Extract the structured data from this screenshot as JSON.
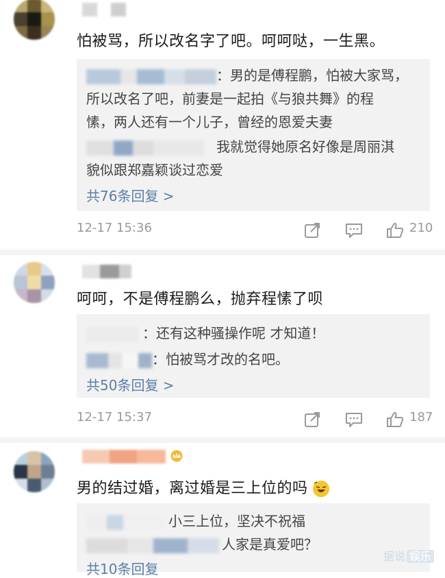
{
  "comments": [
    {
      "text": "怕被骂，所以改名字了吧。呵呵哒，一生黑。",
      "replies": [
        "：男的是傅程鹏，怕被大家骂，",
        "所以改名了吧，前妻是一起拍《与狼共舞》的程",
        "愫，两人还有一个儿子，曾经的恩爱夫妻",
        "我就觉得她原名好像是周丽淇",
        "貌似跟郑嘉颖谈过恋爱"
      ],
      "more_label": "共76条回复 >",
      "time": "12-17 15:36",
      "likes": "210"
    },
    {
      "text": "呵呵，不是傅程鹏么，抛弃程愫了呗",
      "replies": [
        "：还有这种骚操作呢 才知道！",
        "：怕被骂才改的名吧。"
      ],
      "more_label": "共50条回复 >",
      "time": "12-17 15:37",
      "likes": "187"
    },
    {
      "text": "男的结过婚，离过婚是三上位的吗",
      "replies": [
        "小三上位，坚决不祝福",
        "人家是真爱吧？"
      ],
      "more_label": "共10条回复"
    }
  ],
  "watermark": {
    "text": "据说",
    "badge": "娱乐"
  },
  "colors": {
    "link": "#5a7fa8",
    "meta": "#999999",
    "reply_bg": "#f2f2f2"
  },
  "icons": [
    "share-icon",
    "comment-icon",
    "like-icon",
    "vip-crown-icon",
    "laugh-emoji-icon"
  ]
}
